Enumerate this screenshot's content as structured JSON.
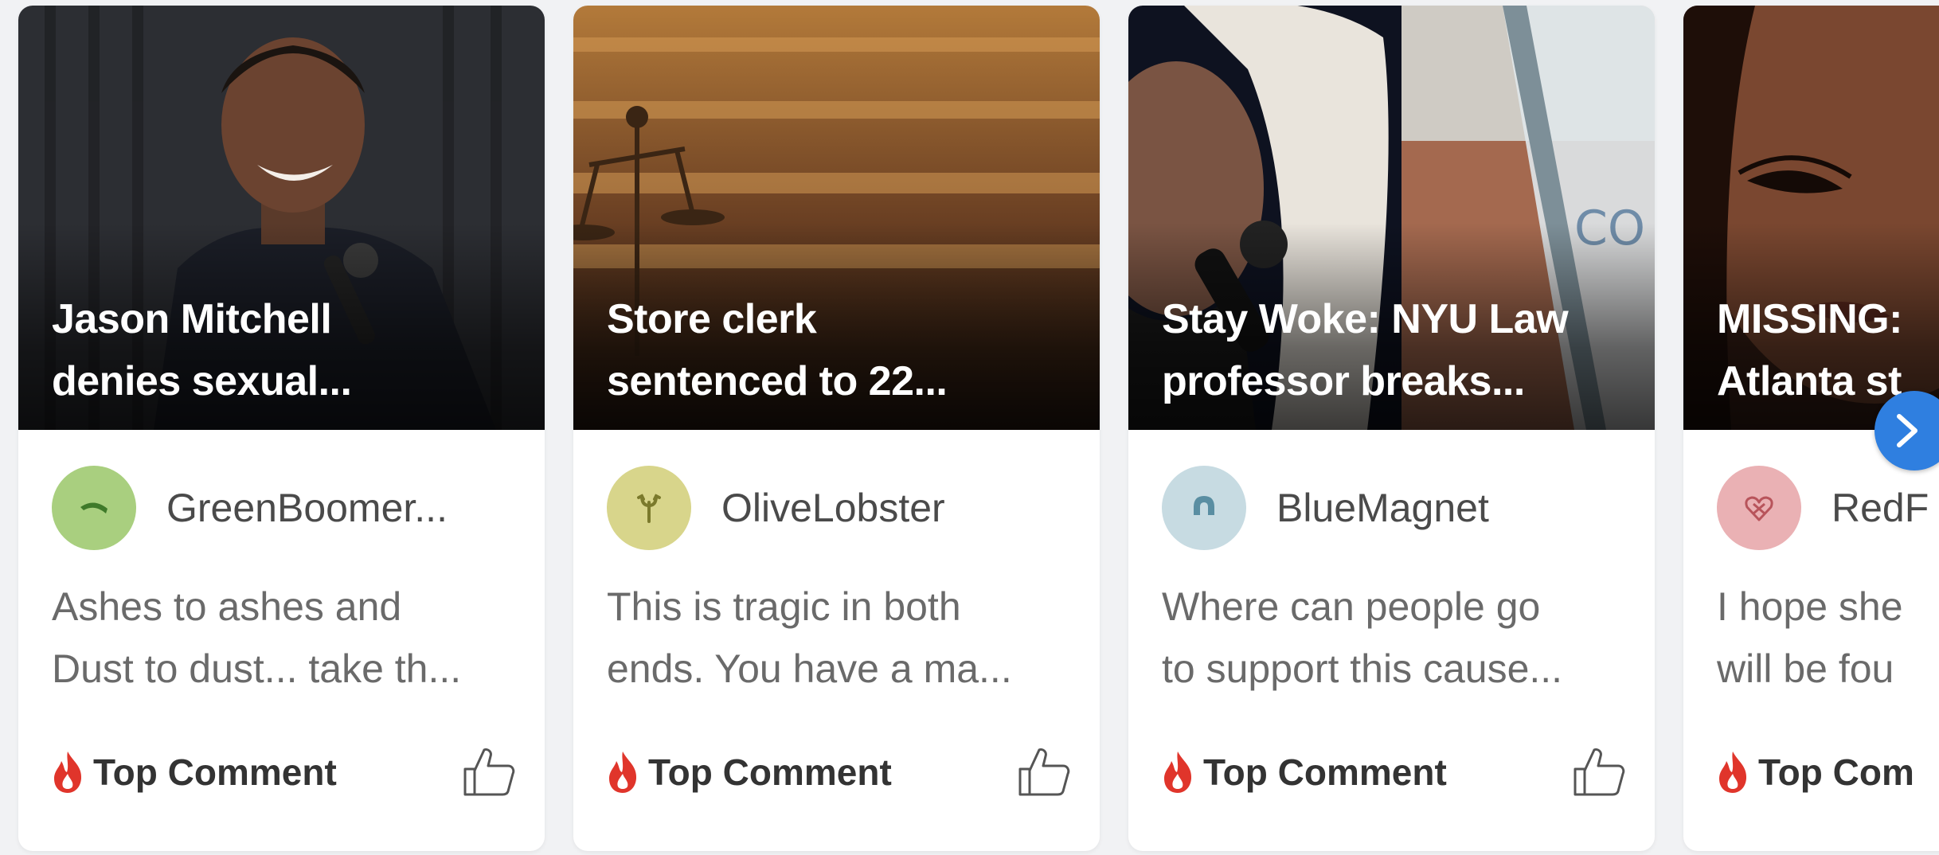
{
  "cards": [
    {
      "headline": "Jason Mitchell\ndenies sexual...",
      "author": "GreenBoomer...",
      "avatar_color": "#a9cf7f",
      "avatar_icon": "boomerang-icon",
      "comment": "Ashes to ashes and\nDust to dust... take th...",
      "badge": "Top Comment"
    },
    {
      "headline": "Store clerk\nsentenced to 22...",
      "author": "OliveLobster",
      "avatar_color": "#d8d58b",
      "avatar_icon": "lobster-icon",
      "comment": "This is tragic in both\nends. You have a ma...",
      "badge": "Top Comment"
    },
    {
      "headline": "Stay Woke: NYU Law\nprofessor breaks...",
      "author": "BlueMagnet",
      "avatar_color": "#c7dbe2",
      "avatar_icon": "magnet-icon",
      "comment": "Where can people go\nto support this cause...",
      "badge": "Top Comment"
    },
    {
      "headline": "MISSING:\nAtlanta st",
      "author": "RedF",
      "avatar_color": "#eab1b4",
      "avatar_icon": "heart-pretzel-icon",
      "comment": "I hope she\nwill be fou",
      "badge": "Top Com"
    }
  ],
  "colors": {
    "fire": "#e0352b",
    "next_button": "#2f7fe0"
  }
}
